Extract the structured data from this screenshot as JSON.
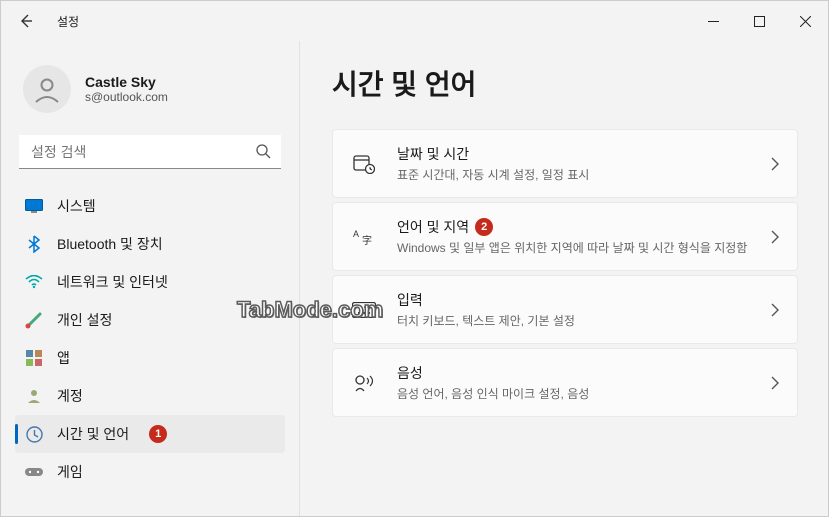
{
  "window": {
    "title": "설정"
  },
  "profile": {
    "name": "Castle Sky",
    "email": "s@outlook.com"
  },
  "search": {
    "placeholder": "설정 검색"
  },
  "page": {
    "title": "시간 및 언어"
  },
  "nav": {
    "system": "시스템",
    "bluetooth": "Bluetooth 및 장치",
    "network": "네트워크 및 인터넷",
    "personalization": "개인 설정",
    "apps": "앱",
    "accounts": "계정",
    "time_language": "시간 및 언어",
    "gaming": "게임"
  },
  "badge1": "1",
  "badge2": "2",
  "cards": {
    "datetime": {
      "title": "날짜 및 시간",
      "desc": "표준 시간대, 자동 시계 설정, 일정 표시"
    },
    "region": {
      "title": "언어 및 지역",
      "desc": "Windows 및 일부 앱은 위치한 지역에 따라 날짜 및 시간 형식을 지정함"
    },
    "typing": {
      "title": "입력",
      "desc": "터치 키보드, 텍스트 제안, 기본 설정"
    },
    "speech": {
      "title": "음성",
      "desc": "음성 언어, 음성 인식 마이크 설정, 음성"
    }
  },
  "watermark": "TabMode.com"
}
